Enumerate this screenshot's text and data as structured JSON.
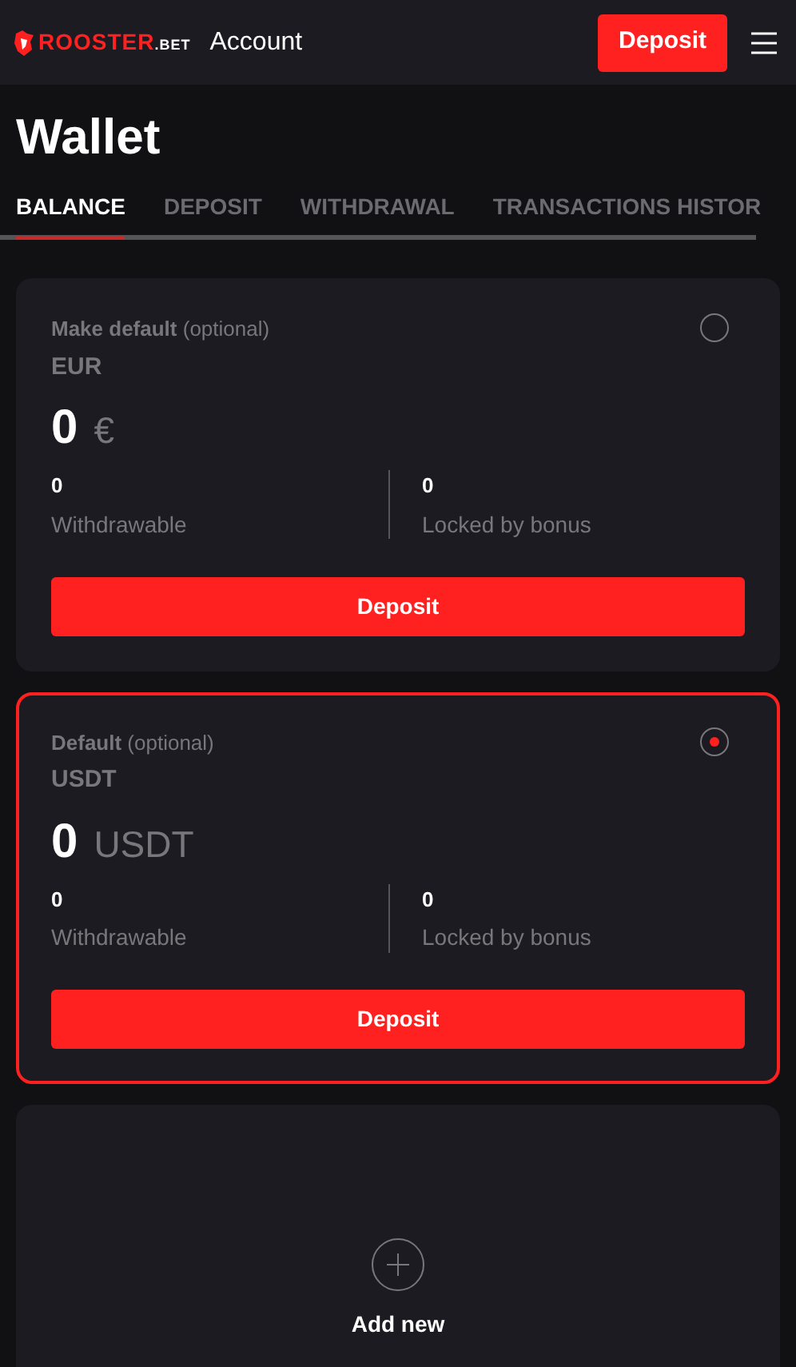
{
  "header": {
    "logo": {
      "name": "ROOSTER",
      "suffix": ".BET"
    },
    "title": "Account",
    "deposit_button": "Deposit"
  },
  "page_title": "Wallet",
  "tabs": [
    {
      "label": "BALANCE",
      "selected": true
    },
    {
      "label": "DEPOSIT",
      "selected": false
    },
    {
      "label": "WITHDRAWAL",
      "selected": false
    },
    {
      "label": "TRANSACTIONS HISTOR",
      "selected": false
    }
  ],
  "wallets": [
    {
      "default_label": "**Make default** (optional)",
      "currency": "EUR",
      "amount": "0",
      "unit": "€",
      "selected": false,
      "withdrawable": "0",
      "withdrawable_label": "Withdrawable",
      "locked": "0",
      "locked_label": "Locked by bonus",
      "button": "Deposit"
    },
    {
      "default_label": "**Default** (optional)",
      "currency": "USDT",
      "amount": "0",
      "unit": "USDT",
      "selected": true,
      "withdrawable": "0",
      "withdrawable_label": "Withdrawable",
      "locked": "0",
      "locked_label": "Locked by bonus",
      "button": "Deposit"
    }
  ],
  "add_new": "Add new"
}
